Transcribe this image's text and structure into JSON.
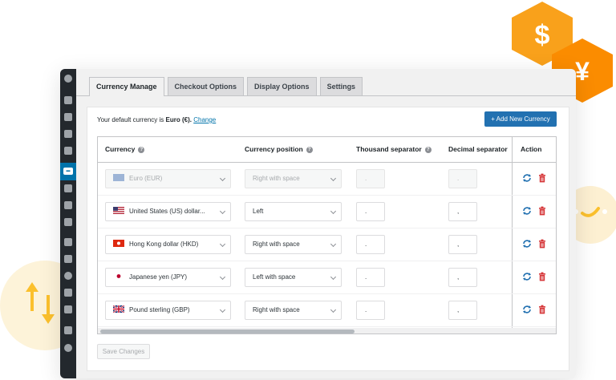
{
  "tabs": [
    {
      "label": "Currency Manage",
      "active": true
    },
    {
      "label": "Checkout Options",
      "active": false
    },
    {
      "label": "Display Options",
      "active": false
    },
    {
      "label": "Settings",
      "active": false
    }
  ],
  "default_currency": {
    "prefix": "Your default currency is ",
    "value": "Euro (€).",
    "link": "Change"
  },
  "add_button": "+ Add New Currency",
  "table": {
    "headers": {
      "currency": "Currency",
      "position": "Currency position",
      "thousand": "Thousand separator",
      "decimal": "Decimal separator",
      "action": "Action"
    },
    "rows": [
      {
        "currency": "Euro (EUR)",
        "flag": "eu-flag-icon",
        "position": "Right with space",
        "thousand": ".",
        "decimal": ".",
        "disabled": true
      },
      {
        "currency": "United States (US) dollar...",
        "flag": "us-flag-icon",
        "position": "Left",
        "thousand": ".",
        "decimal": ",",
        "disabled": false
      },
      {
        "currency": "Hong Kong dollar (HKD)",
        "flag": "hk-flag-icon",
        "position": "Right with space",
        "thousand": ".",
        "decimal": ",",
        "disabled": false
      },
      {
        "currency": "Japanese yen (JPY)",
        "flag": "jp-flag-icon",
        "position": "Left with space",
        "thousand": ".",
        "decimal": ",",
        "disabled": false
      },
      {
        "currency": "Pound sterling (GBP)",
        "flag": "gb-flag-icon",
        "position": "Right with space",
        "thousand": ".",
        "decimal": ",",
        "disabled": false
      }
    ]
  },
  "save_button": "Save Changes",
  "decorations": {
    "dollar_symbol": "$",
    "yen_symbol": "¥"
  },
  "colors": {
    "accent": "#2271b1",
    "coin_orange": "#f9a11b",
    "delete_red": "#d63638",
    "sync_blue": "#2271b1"
  }
}
